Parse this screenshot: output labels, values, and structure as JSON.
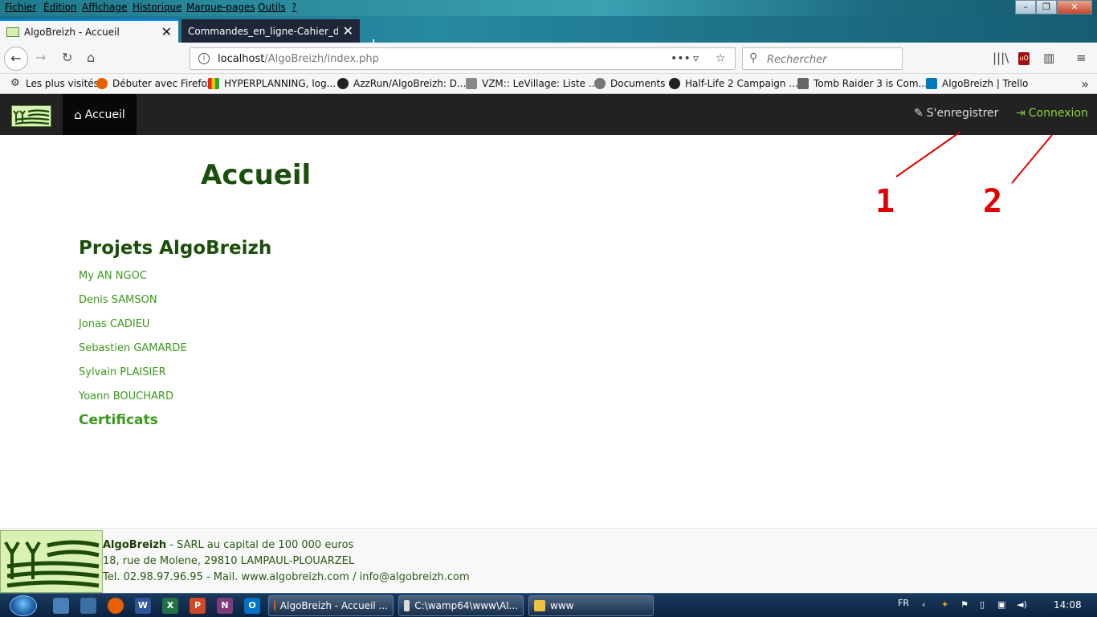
{
  "menu": [
    "Fichier",
    "Édition",
    "Affichage",
    "Historique",
    "Marque-pages",
    "Outils",
    "?"
  ],
  "tabs": [
    {
      "title": "AlgoBreizh - Accueil",
      "close": "✕"
    },
    {
      "title": "Commandes_en_ligne-Cahier_des_",
      "close": "✕"
    }
  ],
  "new_tab": "+",
  "url": {
    "host": "localhost",
    "path": "/AlgoBreizh/index.php"
  },
  "search": {
    "placeholder": "Rechercher"
  },
  "bookmarks": [
    {
      "label": "Les plus visités",
      "icon": "gear-icon"
    },
    {
      "label": "Débuter avec Firefox",
      "icon": "firefox-icon"
    },
    {
      "label": "HYPERPLANNING, log...",
      "icon": "hyperplanning-icon"
    },
    {
      "label": "AzzRun/AlgoBreizh: D...",
      "icon": "github-icon"
    },
    {
      "label": "VZM:: LeVillage: Liste ...",
      "icon": "vzm-icon"
    },
    {
      "label": "Documents",
      "icon": "globe-icon"
    },
    {
      "label": "Half-Life 2 Campaign ...",
      "icon": "github-icon"
    },
    {
      "label": "Tomb Raider 3 is Com...",
      "icon": "tombraider-icon"
    },
    {
      "label": "AlgoBreizh | Trello",
      "icon": "trello-icon"
    }
  ],
  "site_nav": {
    "home": "Accueil",
    "register": "S'enregistrer",
    "login": "Connexion"
  },
  "page": {
    "title": "Accueil",
    "annotations": [
      "1",
      "2"
    ],
    "section_prefix": "Projets Algo",
    "section_bold": "Breizh",
    "people": [
      "My AN NGOC",
      "Denis SAMSON",
      "Jonas CADIEU",
      "Sebastien GAMARDE",
      "Sylvain PLAISIER",
      "Yoann BOUCHARD"
    ],
    "certificats": "Certificats"
  },
  "footer": {
    "brand": "AlgoBreizh",
    "line1_rest": " - SARL au capital de 100 000 euros",
    "line2": "18, rue de Molene, 29810 LAMPAUL-PLOUARZEL",
    "line3": "Tel. 02.98.97.96.95 - Mail. www.algobreizh.com / info@algobreizh.com"
  },
  "taskbar": {
    "tasks": [
      "AlgoBreizh - Accueil ...",
      "C:\\wamp64\\www\\Al...",
      "www"
    ],
    "lang": "FR",
    "time": "14:08"
  },
  "colors": {
    "site_nav_bg": "#222222",
    "login_green": "#8bd43c",
    "title_green": "#1a4f0a",
    "link_green": "#3a9a1a",
    "annotation_red": "#e00000"
  }
}
